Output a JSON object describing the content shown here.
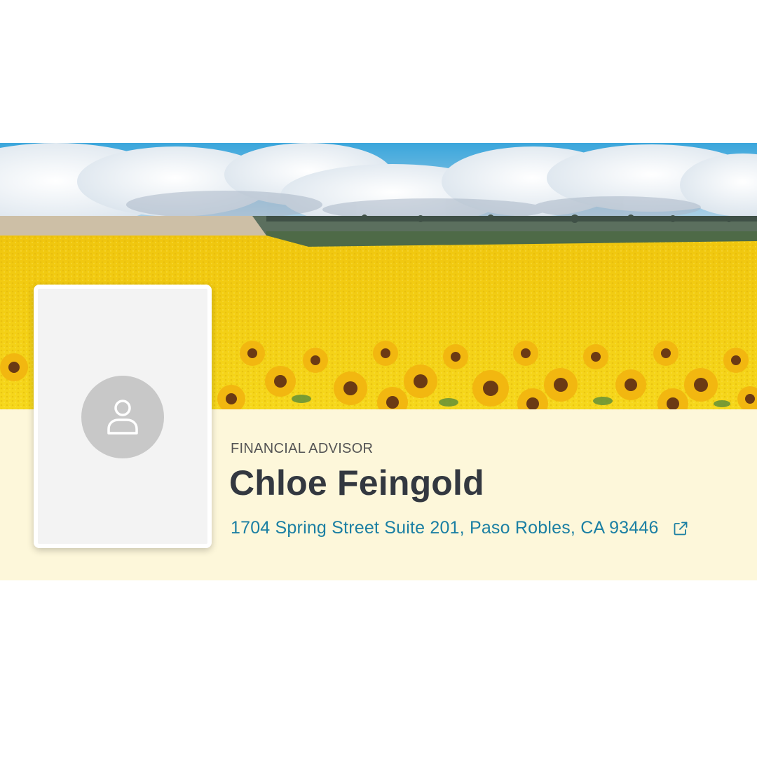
{
  "colors": {
    "banner_sky": "#3ba7de",
    "field_yellow": "#f3cd10",
    "info_band_bg": "#fdf7da",
    "avatar_card_bg": "#f3f3f3",
    "avatar_circle": "#c8c8c8",
    "name_text": "#333840",
    "role_text": "#555555",
    "address_link": "#1b7fa3"
  },
  "profile": {
    "role": "FINANCIAL ADVISOR",
    "name": "Chloe Feingold",
    "address": "1704 Spring Street Suite 201, Paso Robles, CA 93446",
    "address_icon": "external-link-icon",
    "avatar_icon": "user-placeholder-icon"
  },
  "banner": {
    "image": "sunflower-field-photo"
  }
}
